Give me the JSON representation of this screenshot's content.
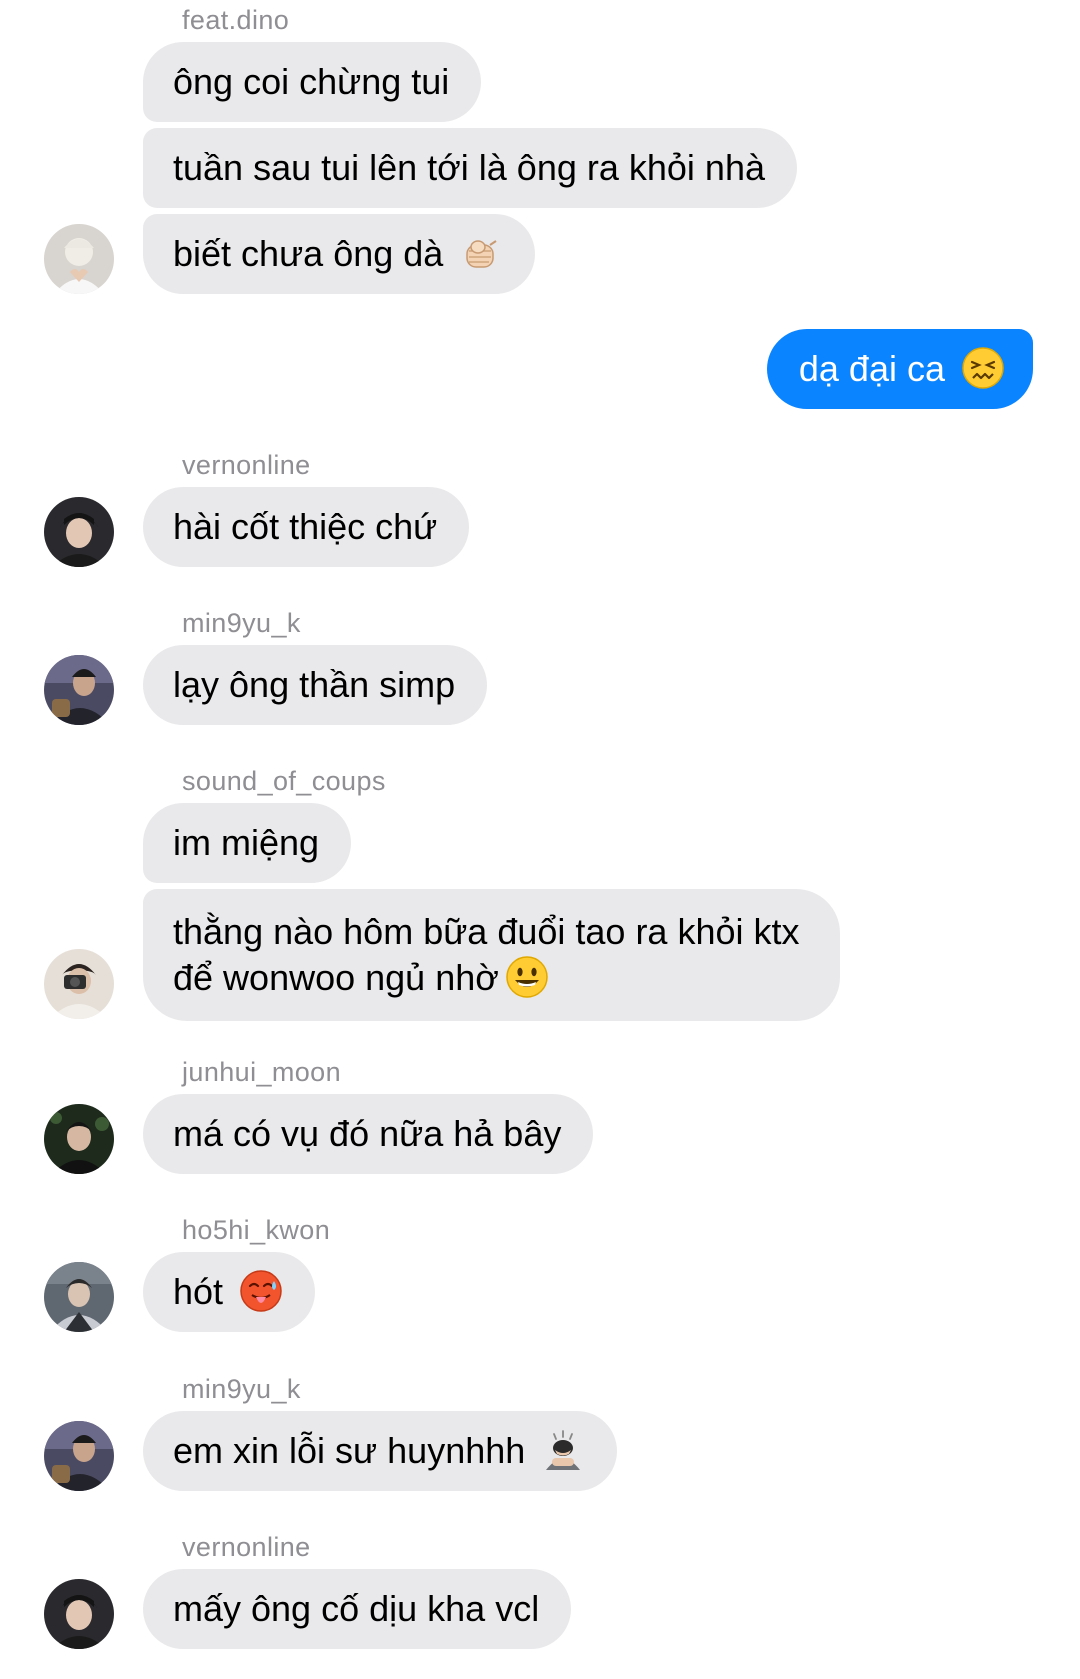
{
  "conversation": [
    {
      "sender": "feat.dino",
      "messages": [
        {
          "text": "ông coi chừng tui"
        },
        {
          "text": "tuần sau tui lên tới là ông ra khỏi nhà"
        },
        {
          "text": "biết chưa ông dà",
          "emoji": "pointing-fist-emoji"
        }
      ]
    },
    {
      "sender": "me",
      "messages": [
        {
          "text": "dạ đại ca",
          "emoji": "confounded-face-emoji"
        }
      ]
    },
    {
      "sender": "vernonline",
      "messages": [
        {
          "text": "hài cốt thiệc chứ"
        }
      ]
    },
    {
      "sender": "min9yu_k",
      "messages": [
        {
          "text": "lạy ông thần simp"
        }
      ]
    },
    {
      "sender": "sound_of_coups",
      "messages": [
        {
          "text": "im miệng"
        },
        {
          "line1": "thằng nào hôm bữa đuổi tao ra khỏi ktx",
          "line2": "để wonwoo ngủ nhờ",
          "emoji": "smiley-face-emoji"
        }
      ]
    },
    {
      "sender": "junhui_moon",
      "messages": [
        {
          "text": "má có vụ đó nữa hả bây"
        }
      ]
    },
    {
      "sender": "ho5hi_kwon",
      "messages": [
        {
          "text": "hót",
          "emoji": "hot-face-emoji"
        }
      ]
    },
    {
      "sender": "min9yu_k",
      "messages": [
        {
          "text": "em xin lỗi sư huynhhh",
          "emoji": "bowing-person-emoji"
        }
      ]
    },
    {
      "sender": "vernonline",
      "messages": [
        {
          "text": "mấy ông cố dịu kha vcl"
        }
      ]
    }
  ],
  "colors": {
    "incoming_bubble": "#e9e9eb",
    "outgoing_bubble": "#0a84ff",
    "sender_name": "#8e8e93",
    "background": "#ffffff"
  }
}
